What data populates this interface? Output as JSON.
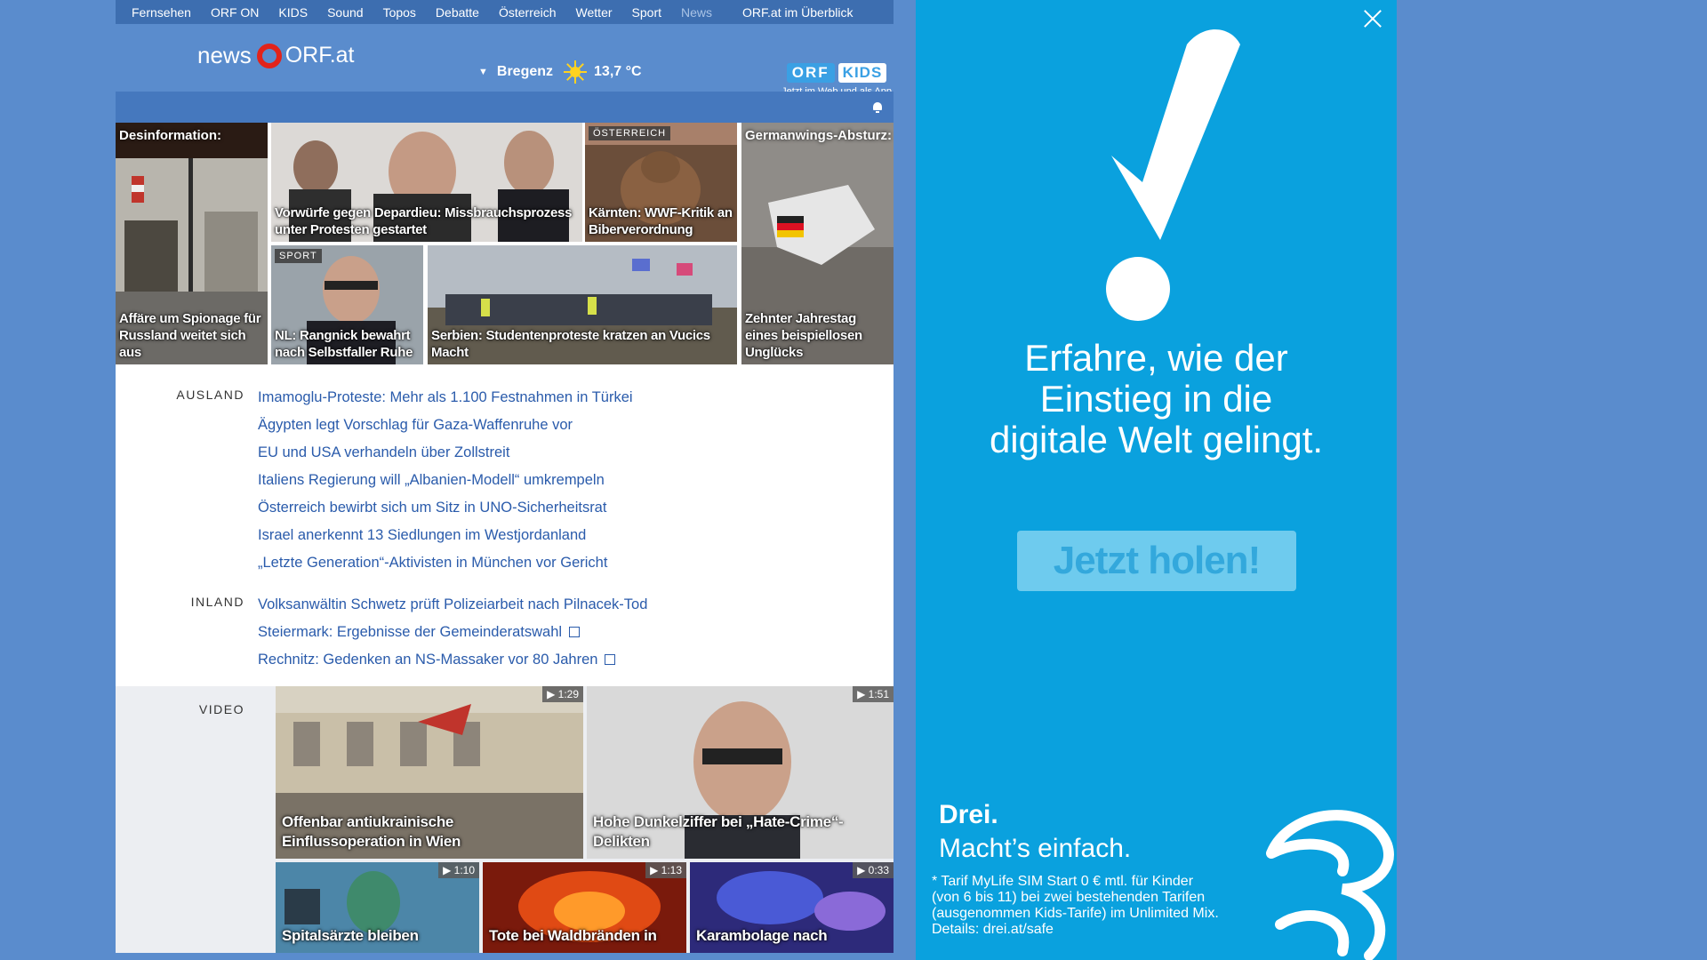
{
  "topnav": {
    "items": [
      "Fernsehen",
      "ORF ON",
      "KIDS",
      "Sound",
      "Topos",
      "Debatte",
      "Österreich",
      "Wetter",
      "Sport",
      "News"
    ],
    "overview": "ORF.at im Überblick"
  },
  "header": {
    "logo_news": "news",
    "logo_orf": "ORF.at",
    "location": "Bregenz",
    "temperature": "13,7 °C",
    "kids_badge_orf": "ORF",
    "kids_badge_kids": "KIDS",
    "kids_sub": "Jetzt im Web und als App"
  },
  "teasers": [
    {
      "toplabel": "Desinformation:",
      "caption": "Affäre um Spionage für Russland weitet sich aus"
    },
    {
      "caption": "Vorwürfe gegen Depardieu: Missbrauchsprozess unter Protesten gestartet"
    },
    {
      "kicker": "ÖSTERREICH",
      "caption": "Kärnten: WWF-Kritik an Biberverordnung"
    },
    {
      "toplabel": "Germanwings-Absturz:",
      "caption": "Zehnter Jahrestag eines beispiellosen Unglücks"
    },
    {
      "kicker": "SPORT",
      "caption": "NL: Rangnick bewahrt nach Selbstfaller Ruhe"
    },
    {
      "caption": "Serbien: Studentenproteste kratzen an Vucics Macht"
    }
  ],
  "sections": {
    "ausland": {
      "label": "AUSLAND",
      "items": [
        "Imamoglu-Proteste: Mehr als 1.100 Festnahmen in Türkei",
        "Ägypten legt Vorschlag für Gaza-Waffenruhe vor",
        "EU und USA verhandeln über Zollstreit",
        "Italiens Regierung will „Albanien-Modell“ umkrempeln",
        "Österreich bewirbt sich um Sitz in UNO-Sicherheitsrat",
        "Israel anerkennt 13 Siedlungen im Westjordanland",
        "„Letzte Generation“-Aktivisten in München vor Gericht"
      ]
    },
    "inland": {
      "label": "INLAND",
      "items": [
        "Volksanwältin Schwetz prüft Polizeiarbeit nach Pilnacek-Tod",
        "Steiermark: Ergebnisse der Gemeinderatswahl",
        "Rechnitz: Gedenken an NS-Massaker vor 80 Jahren"
      ]
    }
  },
  "video": {
    "label": "VIDEO",
    "items": [
      {
        "duration": "▶ 1:29",
        "caption": "Offenbar antiukrainische Einflussoperation in Wien"
      },
      {
        "duration": "▶ 1:51",
        "caption": "Hohe Dunkelziffer bei „Hate-Crime“-Delikten"
      },
      {
        "duration": "▶ 1:10",
        "caption": "Spitalsärzte bleiben"
      },
      {
        "duration": "▶ 1:13",
        "caption": "Tote bei Waldbränden in"
      },
      {
        "duration": "▶ 0:33",
        "caption": "Karambolage nach"
      }
    ]
  },
  "ad": {
    "headline_1": "Erfahre, wie der",
    "headline_2": "Einstieg in die",
    "headline_3": "digitale Welt gelingt.",
    "cta": "Jetzt holen!",
    "brand": "Drei.",
    "slogan": "Macht’s einfach.",
    "fine_1": "* Tarif MyLife SIM Start 0 € mtl. für Kinder",
    "fine_2": "(von 6 bis 11) bei zwei bestehenden Tarifen",
    "fine_3": "(ausgenommen Kids-Tarife) im Unlimited Mix.",
    "fine_4": "Details: drei.at/safe"
  },
  "colors": {
    "page_bg": "#5a8ccd",
    "nav_bg": "#3d6eb0",
    "link": "#2a5bab",
    "ad_bg": "#0aa1de",
    "orf_red": "#e2231a"
  }
}
